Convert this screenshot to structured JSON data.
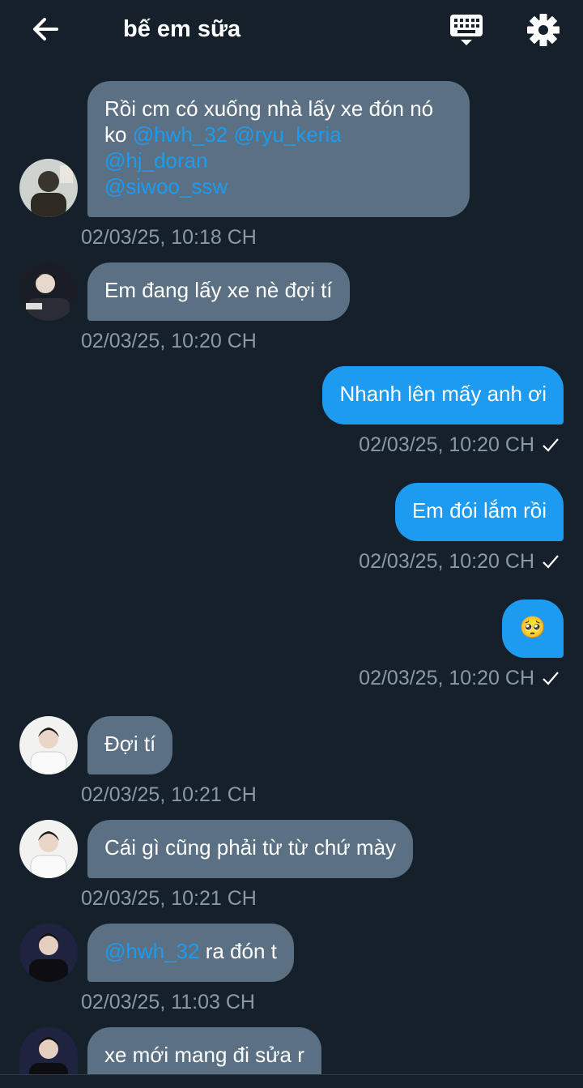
{
  "header": {
    "title": "bế em sữa",
    "back_icon": "arrow-left-icon",
    "keyboard_icon": "keyboard-icon",
    "settings_icon": "gear-icon"
  },
  "colors": {
    "background": "#15202b",
    "incoming_bubble": "#5b7083",
    "outgoing_bubble": "#1d9bf0",
    "mention": "#1d9bf0",
    "timestamp": "#8b98a5"
  },
  "messages": [
    {
      "direction": "in",
      "parts": [
        "Rồi cm có xuống nhà lấy xe đón nó ko "
      ],
      "mentions": [
        "@hwh_32",
        "@ryu_keria",
        "@hj_doran",
        "@siwoo_ssw"
      ],
      "timestamp": "02/03/25, 10:18 CH"
    },
    {
      "direction": "in",
      "text": "Em đang lấy xe nè đợi tí",
      "timestamp": "02/03/25, 10:20 CH"
    },
    {
      "direction": "out",
      "text": "Nhanh lên mấy anh ơi",
      "timestamp": "02/03/25, 10:20 CH",
      "read": true
    },
    {
      "direction": "out",
      "text": "Em đói lắm rồi",
      "timestamp": "02/03/25, 10:20 CH",
      "read": true
    },
    {
      "direction": "out",
      "text": "🥺",
      "timestamp": "02/03/25, 10:20 CH",
      "read": true
    },
    {
      "direction": "in",
      "text": "Đợi tí",
      "timestamp": "02/03/25, 10:21 CH"
    },
    {
      "direction": "in",
      "text": "Cái gì cũng phải từ từ chứ mày",
      "timestamp": "02/03/25, 10:21 CH"
    },
    {
      "direction": "in",
      "mention": "@hwh_32",
      "text": " ra đón t",
      "timestamp": "02/03/25, 11:03 CH"
    },
    {
      "direction": "in",
      "text": "xe mới mang đi sửa r"
    }
  ]
}
